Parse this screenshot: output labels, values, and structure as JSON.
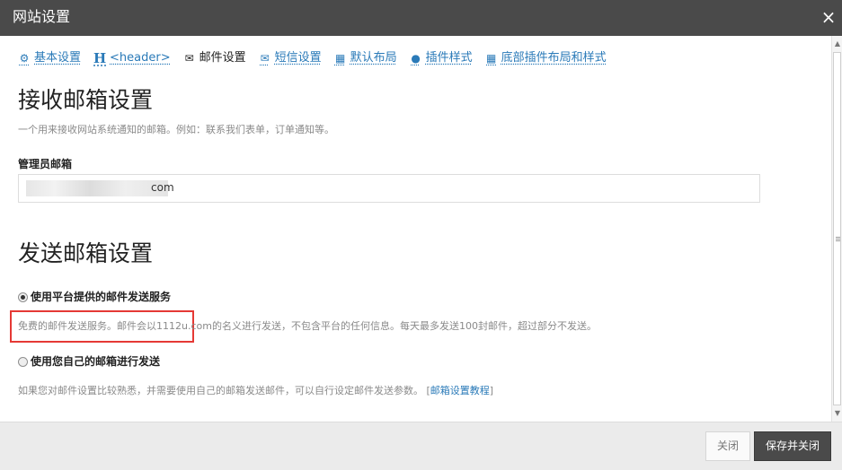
{
  "window": {
    "title": "网站设置",
    "close_glyph": "×"
  },
  "tabs": [
    {
      "label": "基本设置",
      "icon": "gear-icon",
      "glyph": "⚙",
      "active": false
    },
    {
      "label": "<header>",
      "icon": "header-h-icon",
      "glyph": "H",
      "active": false
    },
    {
      "label": "邮件设置",
      "icon": "envelope-icon",
      "glyph": "✉",
      "active": true
    },
    {
      "label": "短信设置",
      "icon": "envelope-icon",
      "glyph": "✉",
      "active": false
    },
    {
      "label": "默认布局",
      "icon": "grid-icon",
      "glyph": "▦",
      "active": false
    },
    {
      "label": "插件样式",
      "icon": "droplet-icon",
      "glyph": "💧",
      "active": false
    },
    {
      "label": "底部插件布局和样式",
      "icon": "grid-dense-icon",
      "glyph": "▦",
      "active": false
    }
  ],
  "receive": {
    "heading": "接收邮箱设置",
    "description": "一个用来接收网站系统通知的邮箱。例如：联系我们表单，订单通知等。",
    "field_label": "管理员邮箱",
    "email_value": "com"
  },
  "send": {
    "heading": "发送邮箱设置",
    "option_platform": {
      "label": "使用平台提供的邮件发送服务",
      "checked": true,
      "description": "免费的邮件发送服务。邮件会以1112u.com的名义进行发送，不包含平台的任何信息。每天最多发送100封邮件，超过部分不发送。"
    },
    "option_own": {
      "label": "使用您自己的邮箱进行发送",
      "checked": false,
      "description": "如果您对邮件设置比较熟悉，并需要使用自己的邮箱发送邮件，可以自行设定邮件发送参数。",
      "link_open": "[",
      "link_text": "邮箱设置教程",
      "link_close": "]"
    }
  },
  "footer": {
    "close_label": "关闭",
    "save_label": "保存并关闭"
  },
  "colors": {
    "titlebar": "#4a4a4a",
    "link": "#2a7ab8",
    "highlight_border": "#e53935",
    "save_button": "#4a4a4a"
  }
}
